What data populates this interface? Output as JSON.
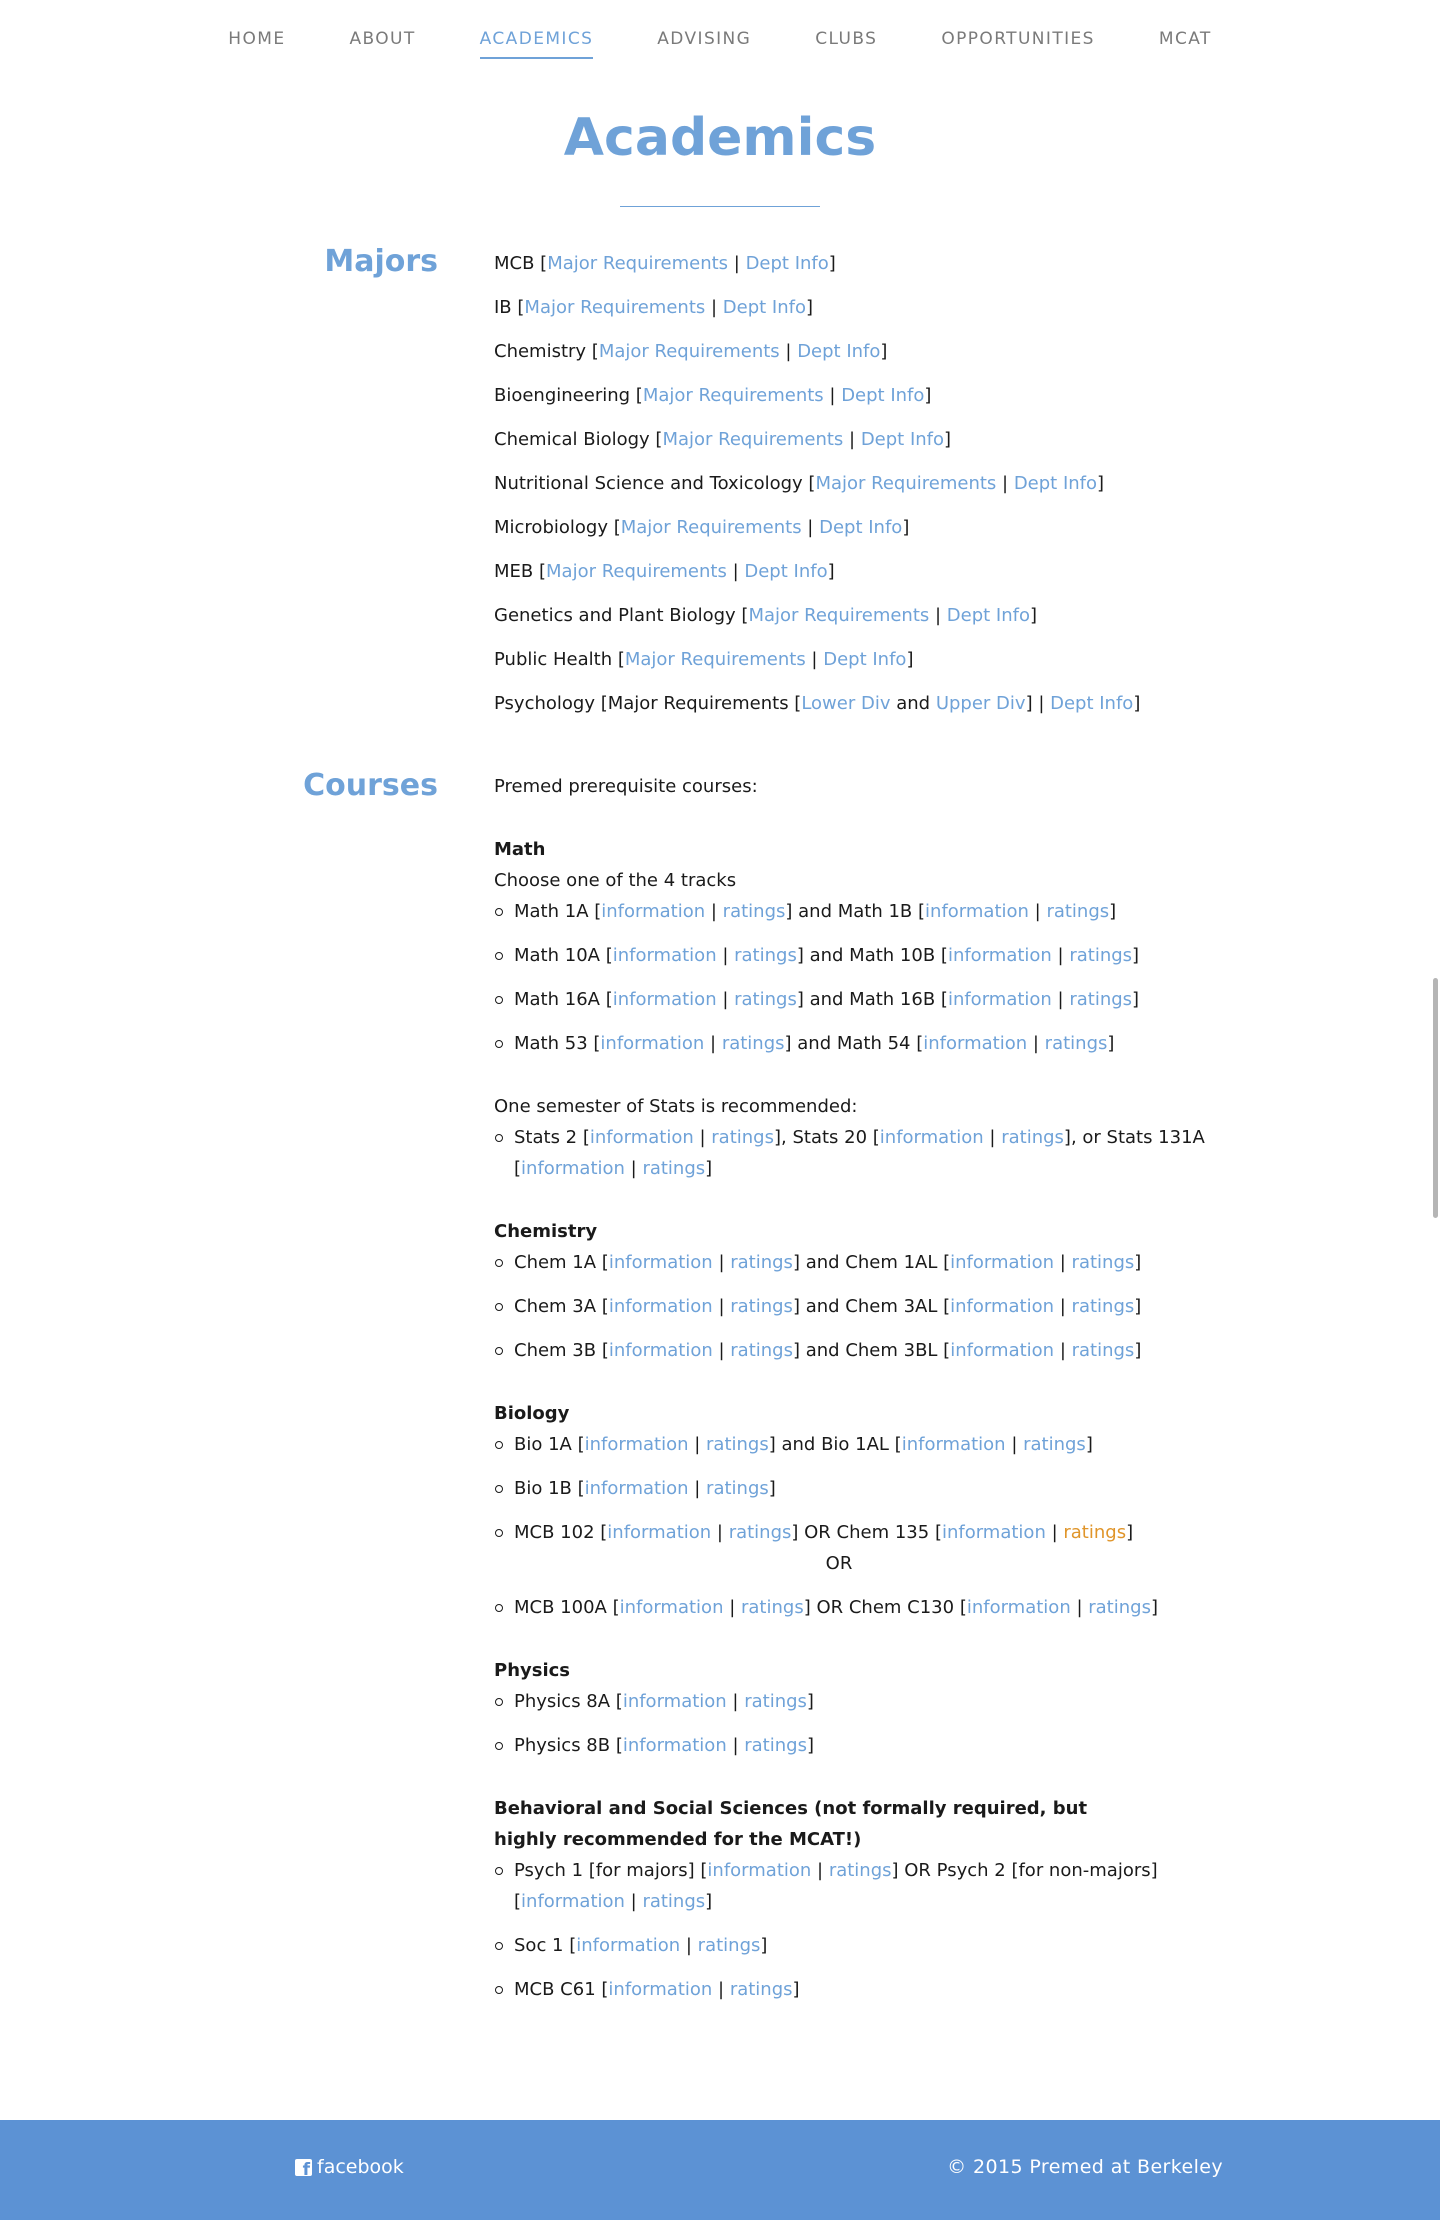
{
  "nav": {
    "items": [
      {
        "label": "HOME",
        "active": false
      },
      {
        "label": "ABOUT",
        "active": false
      },
      {
        "label": "ACADEMICS",
        "active": true
      },
      {
        "label": "ADVISING",
        "active": false
      },
      {
        "label": "CLUBS",
        "active": false
      },
      {
        "label": "OPPORTUNITIES",
        "active": false
      },
      {
        "label": "MCAT",
        "active": false
      }
    ]
  },
  "page": {
    "title": "Academics"
  },
  "majors": {
    "heading": "Majors",
    "items": [
      {
        "name": "MCB",
        "links": [
          "Major Requirements",
          "Dept Info"
        ]
      },
      {
        "name": "IB",
        "links": [
          "Major Requirements",
          "Dept Info"
        ]
      },
      {
        "name": "Chemistry",
        "links": [
          "Major Requirements",
          "Dept Info"
        ]
      },
      {
        "name": "Bioengineering",
        "links": [
          "Major Requirements",
          "Dept Info"
        ]
      },
      {
        "name": "Chemical Biology",
        "links": [
          "Major Requirements",
          "Dept Info"
        ]
      },
      {
        "name": "Nutritional Science and Toxicology",
        "links": [
          "Major Requirements",
          "Dept Info"
        ]
      },
      {
        "name": "Microbiology",
        "links": [
          "Major Requirements",
          "Dept Info"
        ]
      },
      {
        "name": "MEB",
        "links": [
          "Major Requirements",
          "Dept Info"
        ]
      },
      {
        "name": "Genetics and Plant Biology",
        "links": [
          "Major Requirements",
          "Dept Info"
        ]
      },
      {
        "name": "Public Health",
        "links": [
          "Major Requirements",
          "Dept Info"
        ]
      }
    ],
    "psychology": {
      "name": "Psychology",
      "req_label": "Major Requirements",
      "lower": "Lower Div",
      "and": "and",
      "upper": "Upper Div",
      "dept": "Dept Info"
    }
  },
  "courses": {
    "heading": "Courses",
    "intro": "Premed prerequisite courses:",
    "link_info": "information",
    "link_ratings": "ratings",
    "math": {
      "title": "Math",
      "subtitle": "Choose one of the 4 tracks",
      "tracks": [
        {
          "a": "Math 1A",
          "b": "Math 1B"
        },
        {
          "a": "Math 10A",
          "b": "Math 10B"
        },
        {
          "a": "Math 16A",
          "b": "Math 16B"
        },
        {
          "a": "Math 53",
          "b": "Math 54"
        }
      ],
      "stats_intro": "One semester of Stats is recommended:",
      "stats": [
        "Stats 2",
        "Stats 20",
        "Stats 131A"
      ]
    },
    "chemistry": {
      "title": "Chemistry",
      "rows": [
        {
          "a": "Chem 1A",
          "b": "Chem 1AL"
        },
        {
          "a": "Chem 3A",
          "b": "Chem 3AL"
        },
        {
          "a": "Chem 3B",
          "b": "Chem 3BL"
        }
      ]
    },
    "biology": {
      "title": "Biology",
      "row1": {
        "a": "Bio 1A",
        "b": "Bio 1AL"
      },
      "row2": "Bio 1B",
      "row3": {
        "a": "MCB 102",
        "b": "Chem 135"
      },
      "or_label": "OR",
      "row4": {
        "a": "MCB 100A",
        "b": "Chem C130"
      }
    },
    "physics": {
      "title": "Physics",
      "rows": [
        "Physics 8A",
        "Physics 8B"
      ]
    },
    "behavioral": {
      "title": "Behavioral and Social Sciences (not formally required, but highly recommended for the MCAT!)",
      "psych1": "Psych 1 [for majors]",
      "psych2": "Psych 2 [for non-majors]",
      "soc": "Soc 1",
      "mcb": "MCB C61"
    }
  },
  "footer": {
    "facebook": "facebook",
    "copyright": "© 2015 Premed at Berkeley",
    "bg": "#5c92d4"
  },
  "colors": {
    "accent": "#6fa2d8",
    "link_visited": "#e0952a"
  }
}
